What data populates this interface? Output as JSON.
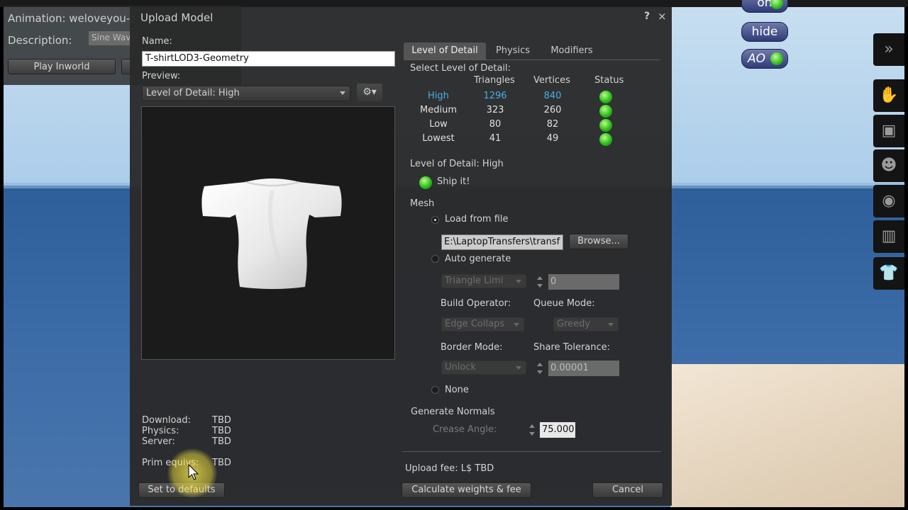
{
  "background_window": {
    "animation_title": "Animation: weloveyou-c",
    "description_label": "Description:",
    "description_value": "Sine Wav",
    "play_inworld_label": "Play Inworld"
  },
  "hud": {
    "top_label": "on",
    "hide_label": "hide",
    "ao_label": "AO"
  },
  "sidebar": {
    "items": [
      {
        "icon": "double-chevron-right-icon",
        "glyph": "»"
      },
      {
        "icon": "hand-icon",
        "glyph": "✋"
      },
      {
        "icon": "person-card-icon",
        "glyph": "▣"
      },
      {
        "icon": "people-icon",
        "glyph": "☻"
      },
      {
        "icon": "globe-icon",
        "glyph": "◉"
      },
      {
        "icon": "inventory-icon",
        "glyph": "▥"
      },
      {
        "icon": "shirt-icon",
        "glyph": "👕"
      }
    ]
  },
  "dialog": {
    "title": "Upload Model",
    "help": "?",
    "close": "×",
    "name_label": "Name:",
    "name_value": "T-shirtLOD3-Geometry",
    "preview_label": "Preview:",
    "preview_lod": "Level of Detail: High",
    "stats": [
      {
        "key": "Download:",
        "value": "TBD"
      },
      {
        "key": "Physics:",
        "value": "TBD"
      },
      {
        "key": "Server:",
        "value": "TBD"
      },
      {
        "key": "Prim equivs:",
        "value": "TBD"
      }
    ],
    "set_defaults": "Set to defaults",
    "calculate": "Calculate weights & fee",
    "cancel": "Cancel",
    "upload_fee": "Upload fee: L$ TBD"
  },
  "tabs": [
    {
      "label": "Level of Detail",
      "active": true
    },
    {
      "label": "Physics",
      "active": false
    },
    {
      "label": "Modifiers",
      "active": false
    }
  ],
  "lod": {
    "select_label": "Select Level of Detail:",
    "headers": {
      "triangles": "Triangles",
      "vertices": "Vertices",
      "status": "Status"
    },
    "rows": [
      {
        "level": "High",
        "triangles": "1296",
        "vertices": "840",
        "highlight": true
      },
      {
        "level": "Medium",
        "triangles": "323",
        "vertices": "260",
        "highlight": false
      },
      {
        "level": "Low",
        "triangles": "80",
        "vertices": "82",
        "highlight": false
      },
      {
        "level": "Lowest",
        "triangles": "41",
        "vertices": "49",
        "highlight": false
      }
    ],
    "current_label": "Level of Detail: High",
    "ship_it": "Ship it!",
    "status_color": "#2fbd1c"
  },
  "mesh": {
    "label": "Mesh",
    "load_from_file": "Load from file",
    "file_path": "E:\\LaptopTransfers\\transf",
    "browse": "Browse...",
    "auto_generate": "Auto generate",
    "triangle_limit": "Triangle Limi",
    "triangle_value": "0",
    "build_operator_label": "Build Operator:",
    "build_operator_value": "Edge Collaps",
    "queue_mode_label": "Queue Mode:",
    "queue_mode_value": "Greedy",
    "border_mode_label": "Border Mode:",
    "border_mode_value": "Unlock",
    "share_tolerance_label": "Share Tolerance:",
    "share_tolerance_value": "0.00001",
    "none": "None"
  },
  "normals": {
    "label": "Generate Normals",
    "crease_label": "Crease Angle:",
    "crease_value": "75.000"
  }
}
